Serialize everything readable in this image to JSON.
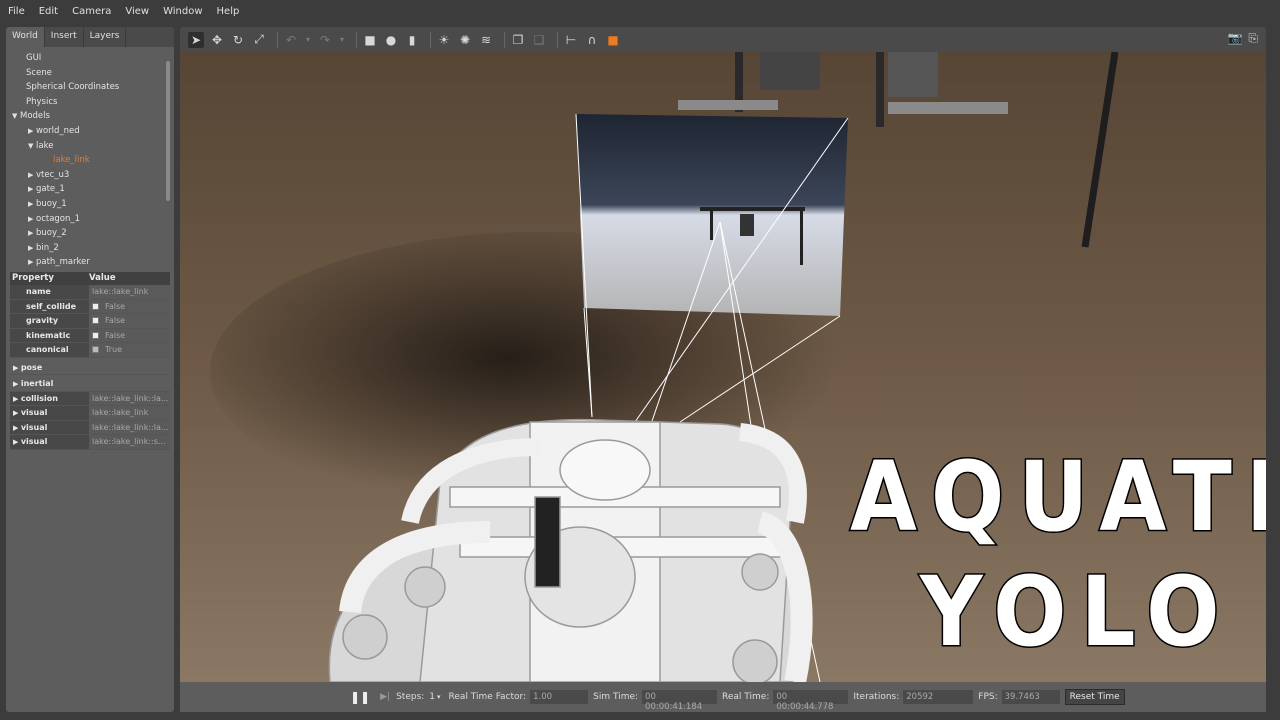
{
  "menu": [
    "File",
    "Edit",
    "Camera",
    "View",
    "Window",
    "Help"
  ],
  "tabs": [
    "World",
    "Insert",
    "Layers"
  ],
  "tree": [
    {
      "label": "GUI",
      "level": 1,
      "arrow": ""
    },
    {
      "label": "Scene",
      "level": 1,
      "arrow": ""
    },
    {
      "label": "Spherical Coordinates",
      "level": 1,
      "arrow": ""
    },
    {
      "label": "Physics",
      "level": 1,
      "arrow": ""
    },
    {
      "label": "Models",
      "level": 0,
      "arrow": "▼"
    },
    {
      "label": "world_ned",
      "level": 2,
      "arrow": "▶"
    },
    {
      "label": "lake",
      "level": 2,
      "arrow": "▼"
    },
    {
      "label": "lake_link",
      "level": 3,
      "arrow": "",
      "selected": true
    },
    {
      "label": "vtec_u3",
      "level": 2,
      "arrow": "▶"
    },
    {
      "label": "gate_1",
      "level": 2,
      "arrow": "▶"
    },
    {
      "label": "buoy_1",
      "level": 2,
      "arrow": "▶"
    },
    {
      "label": "octagon_1",
      "level": 2,
      "arrow": "▶"
    },
    {
      "label": "buoy_2",
      "level": 2,
      "arrow": "▶"
    },
    {
      "label": "bin_2",
      "level": 2,
      "arrow": "▶"
    },
    {
      "label": "path_marker",
      "level": 2,
      "arrow": "▶"
    }
  ],
  "properties": {
    "header_property": "Property",
    "header_value": "Value",
    "rows": [
      {
        "name": "name",
        "value": "lake::lake_link",
        "type": "text"
      },
      {
        "name": "self_collide",
        "value": "False",
        "type": "check",
        "checked": false
      },
      {
        "name": "gravity",
        "value": "False",
        "type": "check",
        "checked": false
      },
      {
        "name": "kinematic",
        "value": "False",
        "type": "check",
        "checked": false
      },
      {
        "name": "canonical",
        "value": "True",
        "type": "check",
        "checked": true
      }
    ],
    "groups": [
      {
        "name": "pose",
        "value": ""
      },
      {
        "name": "inertial",
        "value": ""
      },
      {
        "name": "collision",
        "value": "lake::lake_link::la..."
      },
      {
        "name": "visual",
        "value": "lake::lake_link"
      },
      {
        "name": "visual",
        "value": "lake::lake_link::la..."
      },
      {
        "name": "visual",
        "value": "lake::lake_link::s..."
      }
    ]
  },
  "toolbar_icons": [
    "select-arrow-icon",
    "translate-icon",
    "rotate-icon",
    "scale-icon",
    "undo-icon",
    "undo-dropdown-icon",
    "redo-icon",
    "redo-dropdown-icon",
    "box-icon",
    "sphere-icon",
    "cylinder-icon",
    "point-light-icon",
    "spot-light-icon",
    "directional-light-icon",
    "copy-icon",
    "paste-icon",
    "align-icon",
    "snap-icon",
    "color-icon"
  ],
  "status": {
    "steps_label": "Steps:",
    "steps_value": "1",
    "rtf_label": "Real Time Factor:",
    "rtf_value": "1.00",
    "sim_label": "Sim Time:",
    "sim_value": "00 00:00:41.184",
    "real_label": "Real Time:",
    "real_value": "00 00:00:44.778",
    "iter_label": "Iterations:",
    "iter_value": "20592",
    "fps_label": "FPS:",
    "fps_value": "39.7463",
    "reset_label": "Reset Time"
  },
  "overlay": {
    "line1": "AQUATIC",
    "line2": "YOLO"
  },
  "colors": {
    "selected": "#f07a1f",
    "panel": "#5d5d5d",
    "background": "#3c3c3c"
  }
}
